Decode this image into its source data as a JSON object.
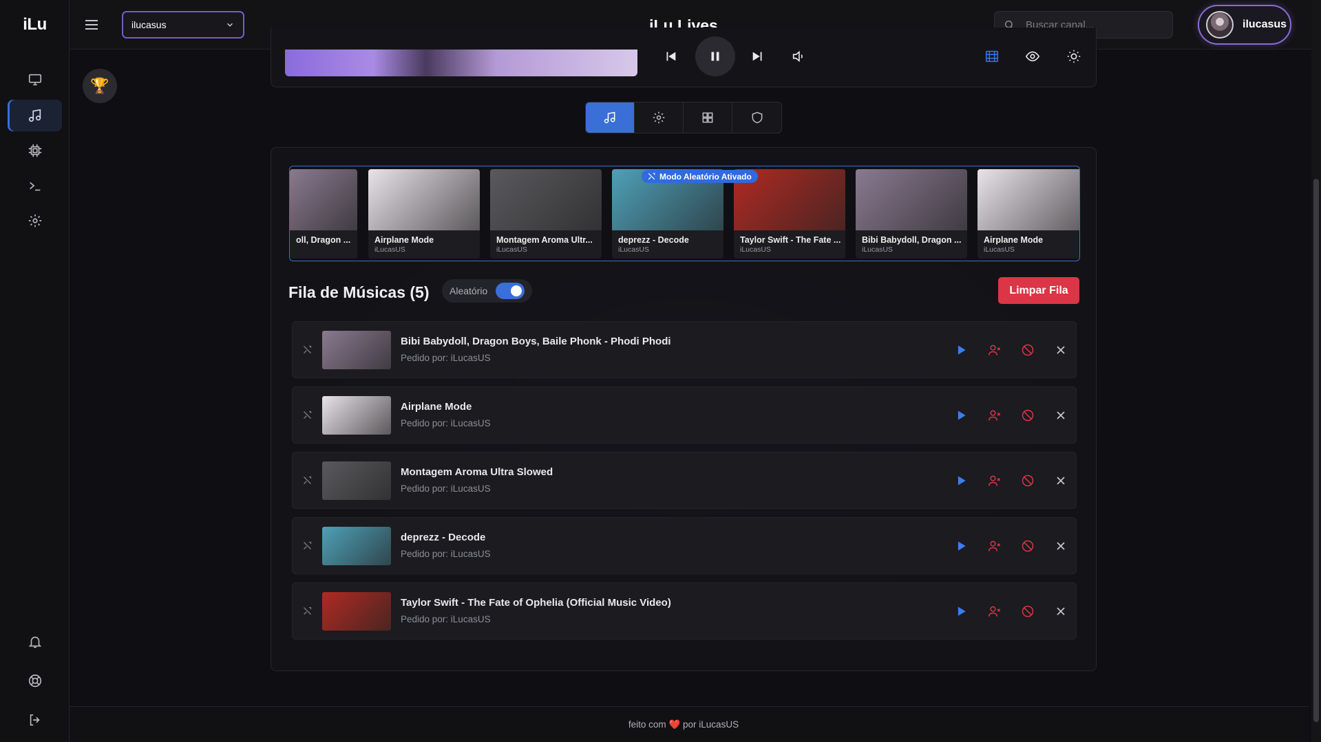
{
  "app": {
    "logo": "iLu",
    "title": "iLu Lives"
  },
  "topbar": {
    "channel_select": "ilucasus",
    "search_placeholder": "Buscar canal...",
    "username": "ilucasus"
  },
  "sidebar": {
    "items": [
      {
        "name": "monitor",
        "active": false
      },
      {
        "name": "music",
        "active": true
      },
      {
        "name": "chip",
        "active": false
      },
      {
        "name": "terminal",
        "active": false
      },
      {
        "name": "settings",
        "active": false
      }
    ],
    "bottom_items": [
      "bell",
      "lifebuoy",
      "logout"
    ]
  },
  "tabs": [
    "music",
    "settings",
    "grid",
    "shield"
  ],
  "carousel": {
    "badge": "Modo Aleatório Ativado",
    "items": [
      {
        "title": "oll, Dragon ...",
        "requester": "",
        "color": "#8a7a90"
      },
      {
        "title": "Airplane Mode",
        "requester": "iLucasUS",
        "color": "#e9e2ea"
      },
      {
        "title": "Montagem Aroma Ultr...",
        "requester": "iLucasUS",
        "color": "#5a5a5e"
      },
      {
        "title": "deprezz - Decode",
        "requester": "iLucasUS",
        "color": "#4fa0b8"
      },
      {
        "title": "Taylor Swift - The Fate ...",
        "requester": "iLucasUS",
        "color": "#b02a22"
      },
      {
        "title": "Bibi Babydoll, Dragon ...",
        "requester": "iLucasUS",
        "color": "#8a7a90"
      },
      {
        "title": "Airplane Mode",
        "requester": "iLucasUS",
        "color": "#e9e2ea"
      }
    ]
  },
  "queue": {
    "title": "Fila de Músicas (5)",
    "shuffle_label": "Aleatório",
    "shuffle_on": true,
    "clear_label": "Limpar Fila",
    "items": [
      {
        "name": "Bibi Babydoll, Dragon Boys, Baile Phonk - Phodi Phodi",
        "requested_by": "Pedido por: iLucasUS",
        "color": "#8a7a90"
      },
      {
        "name": "Airplane Mode",
        "requested_by": "Pedido por: iLucasUS",
        "color": "#e9e2ea"
      },
      {
        "name": "Montagem Aroma Ultra Slowed",
        "requested_by": "Pedido por: iLucasUS",
        "color": "#5a5a5e"
      },
      {
        "name": "deprezz - Decode",
        "requested_by": "Pedido por: iLucasUS",
        "color": "#4fa0b8"
      },
      {
        "name": "Taylor Swift - The Fate of Ophelia (Official Music Video)",
        "requested_by": "Pedido por: iLucasUS",
        "color": "#b02a22"
      }
    ]
  },
  "footer": {
    "prefix": "feito com",
    "suffix": "por iLucasUS"
  },
  "colors": {
    "accent": "#3a6fd8",
    "danger": "#dc3545",
    "border_glow": "#8b6ad8"
  }
}
